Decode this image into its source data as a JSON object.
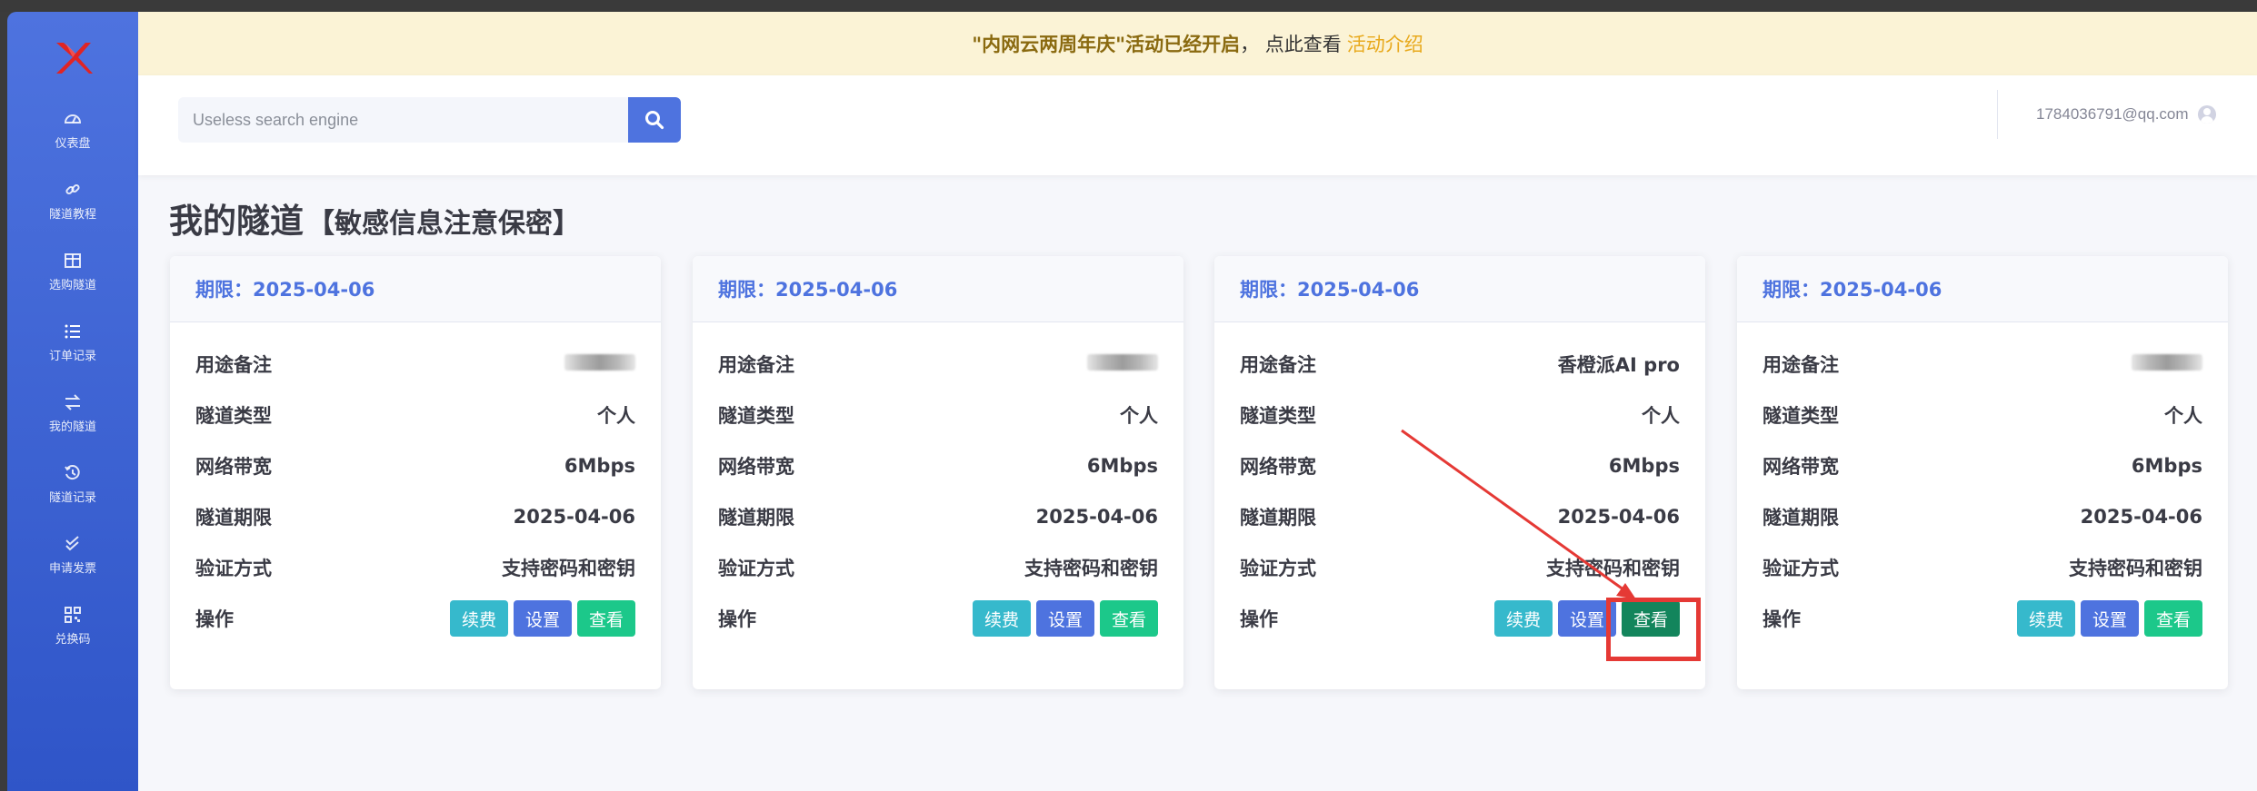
{
  "banner": {
    "highlight": "\"内网云两周年庆\"活动已经开启",
    "text": "， 点此查看",
    "link": "活动介绍"
  },
  "search": {
    "placeholder": "Useless search engine"
  },
  "user": {
    "email": "1784036791@qq.com"
  },
  "sidebar": {
    "items": [
      {
        "label": "仪表盘",
        "icon": "dashboard-icon"
      },
      {
        "label": "隧道教程",
        "icon": "link-icon"
      },
      {
        "label": "选购隧道",
        "icon": "table-icon"
      },
      {
        "label": "订单记录",
        "icon": "list-icon"
      },
      {
        "label": "我的隧道",
        "icon": "exchange-icon"
      },
      {
        "label": "隧道记录",
        "icon": "history-icon"
      },
      {
        "label": "申请发票",
        "icon": "check-double-icon"
      },
      {
        "label": "兑换码",
        "icon": "qrcode-icon"
      }
    ]
  },
  "page": {
    "title": "我的隧道",
    "subtitle": "【敏感信息注意保密】"
  },
  "labels": {
    "usage_note": "用途备注",
    "tunnel_type": "隧道类型",
    "bandwidth": "网络带宽",
    "expiry": "隧道期限",
    "auth": "验证方式",
    "actions": "操作"
  },
  "buttons": {
    "renew": "续费",
    "settings": "设置",
    "view": "查看"
  },
  "cards": [
    {
      "header": "期限：2025-04-06",
      "usage_note": "",
      "usage_note_redacted": true,
      "tunnel_type": "个人",
      "bandwidth": "6Mbps",
      "expiry": "2025-04-06",
      "auth": "支持密码和密钥"
    },
    {
      "header": "期限：2025-04-06",
      "usage_note": "",
      "usage_note_redacted": true,
      "tunnel_type": "个人",
      "bandwidth": "6Mbps",
      "expiry": "2025-04-06",
      "auth": "支持密码和密钥"
    },
    {
      "header": "期限：2025-04-06",
      "usage_note": "香橙派AI pro",
      "usage_note_redacted": false,
      "tunnel_type": "个人",
      "bandwidth": "6Mbps",
      "expiry": "2025-04-06",
      "auth": "支持密码和密钥"
    },
    {
      "header": "期限：2025-04-06",
      "usage_note": "",
      "usage_note_redacted": true,
      "tunnel_type": "个人",
      "bandwidth": "6Mbps",
      "expiry": "2025-04-06",
      "auth": "支持密码和密钥"
    }
  ],
  "colors": {
    "primary": "#4e73df",
    "info": "#36b9cc",
    "success": "#1cc88a",
    "annotation": "#e53935",
    "banner_bg": "#fbf3d6"
  }
}
